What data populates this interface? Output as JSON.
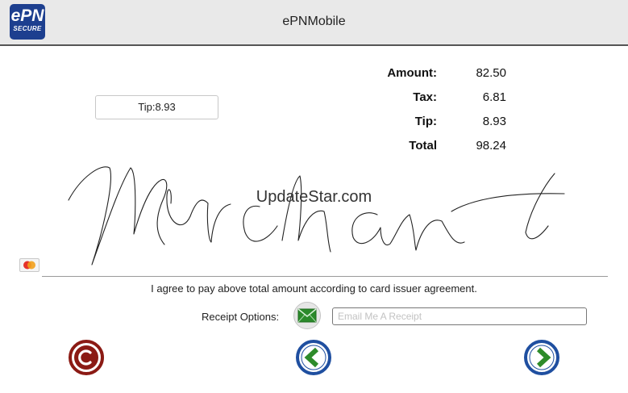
{
  "header": {
    "title": "ePNMobile",
    "logo": {
      "line1": "ePN",
      "line2": "SECURE",
      "color": "#1d3f8f"
    }
  },
  "tip_button": {
    "label": "Tip:8.93"
  },
  "summary": [
    {
      "label": "Amount:",
      "value": "82.50"
    },
    {
      "label": "Tax:",
      "value": "6.81"
    },
    {
      "label": "Tip:",
      "value": "8.93"
    },
    {
      "label": "Total",
      "value": "98.24"
    }
  ],
  "watermark": "UpdateStar.com",
  "signature": {
    "text": "Merchant"
  },
  "card_brand_icon": "mastercard-icon",
  "agreement": "I agree to pay above total amount according to card issuer agreement.",
  "receipt": {
    "label": "Receipt Options:",
    "email_icon": "envelope-icon",
    "email_placeholder": "Email Me A Receipt",
    "email_value": ""
  },
  "buttons": {
    "cancel_icon": "cancel-c-icon",
    "back_icon": "chevron-left-icon",
    "next_icon": "chevron-right-icon"
  },
  "colors": {
    "cancel": "#8b1a14",
    "nav_ring": "#1f4fa0",
    "nav_arrow": "#2e8b2a",
    "envelope": "#2a8a2a"
  }
}
